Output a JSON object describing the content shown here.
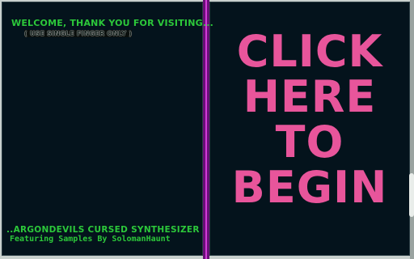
{
  "left_panel": {
    "welcome_text": "WELCOME, THANK YOU FOR VISITING...",
    "instruction_text": "( USE SINGLE FINGER ONLY )",
    "credit_title": "..ARGONDEVILS CURSED SYNTHESIZER",
    "credit_subtitle": "Featuring Samples By SolomanHaunt"
  },
  "right_panel": {
    "cta_lines": [
      "CLICK",
      "HERE",
      "TO",
      "BEGIN"
    ]
  },
  "colors": {
    "background": "#04131c",
    "accent_green": "#2cc83a",
    "accent_pink": "#e8559b",
    "divider_purple": "#d23bd8"
  }
}
